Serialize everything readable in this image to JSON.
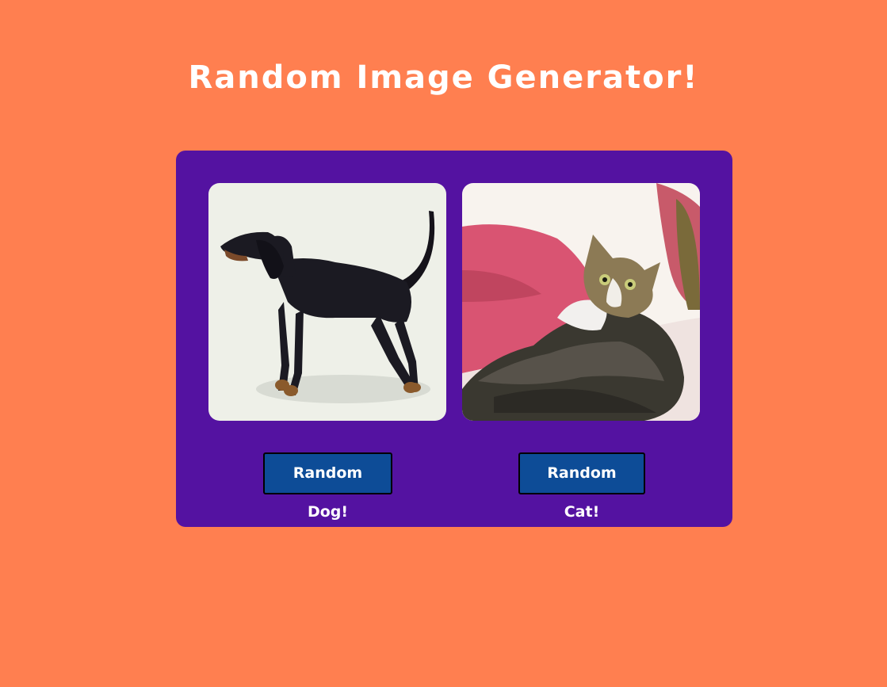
{
  "title": "Random Image Generator!",
  "colors": {
    "page_background": "#ff7f50",
    "card_background": "#5412a1",
    "button_background": "#0d4c97",
    "title_text": "#ffffff"
  },
  "images": {
    "dog_image": "dog-photo",
    "cat_image": "cat-photo"
  },
  "buttons": {
    "dog_label": "Random Dog!",
    "cat_label": "Random Cat!"
  }
}
